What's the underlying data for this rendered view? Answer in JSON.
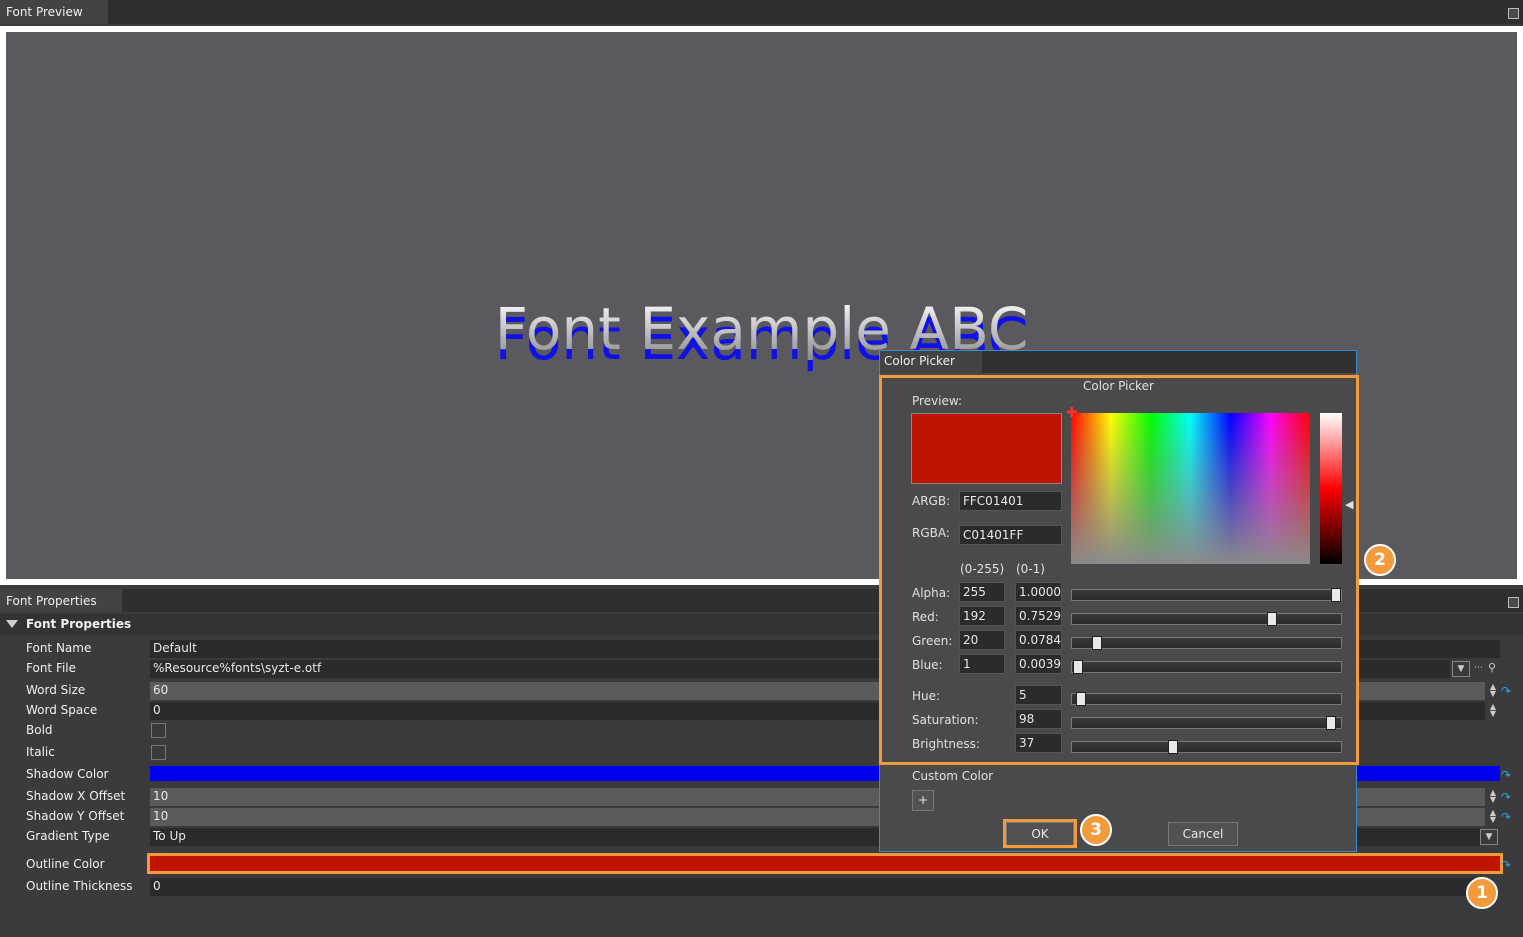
{
  "preview_panel": {
    "tab_title": "Font Preview",
    "sample_text": "Font Example ABC"
  },
  "props_panel": {
    "tab_title": "Font Properties",
    "section_title": "Font Properties",
    "rows": {
      "font_name": {
        "label": "Font Name",
        "value": "Default"
      },
      "font_file": {
        "label": "Font File",
        "value": "%Resource%fonts\\syzt-e.otf"
      },
      "word_size": {
        "label": "Word Size",
        "value": "60"
      },
      "word_space": {
        "label": "Word Space",
        "value": "0"
      },
      "bold": {
        "label": "Bold"
      },
      "italic": {
        "label": "Italic"
      },
      "shadow_color": {
        "label": "Shadow Color",
        "color": "#0000ee"
      },
      "shadow_x": {
        "label": "Shadow X Offset",
        "value": "10"
      },
      "shadow_y": {
        "label": "Shadow Y Offset",
        "value": "10"
      },
      "gradient_type": {
        "label": "Gradient Type",
        "value": "To Up"
      },
      "outline_color": {
        "label": "Outline Color",
        "color": "#c01401"
      },
      "outline_thickness": {
        "label": "Outline Thickness",
        "value": "0"
      }
    }
  },
  "color_picker": {
    "window_title": "Color Picker",
    "header": "Color Picker",
    "preview_label": "Preview:",
    "preview_color": "#c01401",
    "argb_label": "ARGB:",
    "argb_value": "FFC01401",
    "rgba_label": "RGBA:",
    "rgba_value": "C01401FF",
    "col_255": "(0-255)",
    "col_01": "(0-1)",
    "channels": {
      "alpha": {
        "label": "Alpha:",
        "v255": "255",
        "v01": "1.0000",
        "level": 1.0
      },
      "red": {
        "label": "Red:",
        "v255": "192",
        "v01": "0.7529",
        "level": 0.7529
      },
      "green": {
        "label": "Green:",
        "v255": "20",
        "v01": "0.0784",
        "level": 0.0784
      },
      "blue": {
        "label": "Blue:",
        "v255": "1",
        "v01": "0.0039",
        "level": 0.0039
      }
    },
    "hsb": {
      "hue": {
        "label": "Hue:",
        "value": "5",
        "level": 0.014
      },
      "saturation": {
        "label": "Saturation:",
        "value": "98",
        "level": 0.98
      },
      "brightness": {
        "label": "Brightness:",
        "value": "37",
        "level": 0.37
      }
    },
    "custom_color_label": "Custom Color",
    "add_symbol": "+",
    "ok_label": "OK",
    "cancel_label": "Cancel"
  },
  "callouts": {
    "one": "1",
    "two": "2",
    "three": "3"
  },
  "accent_color": "#f39a3c"
}
